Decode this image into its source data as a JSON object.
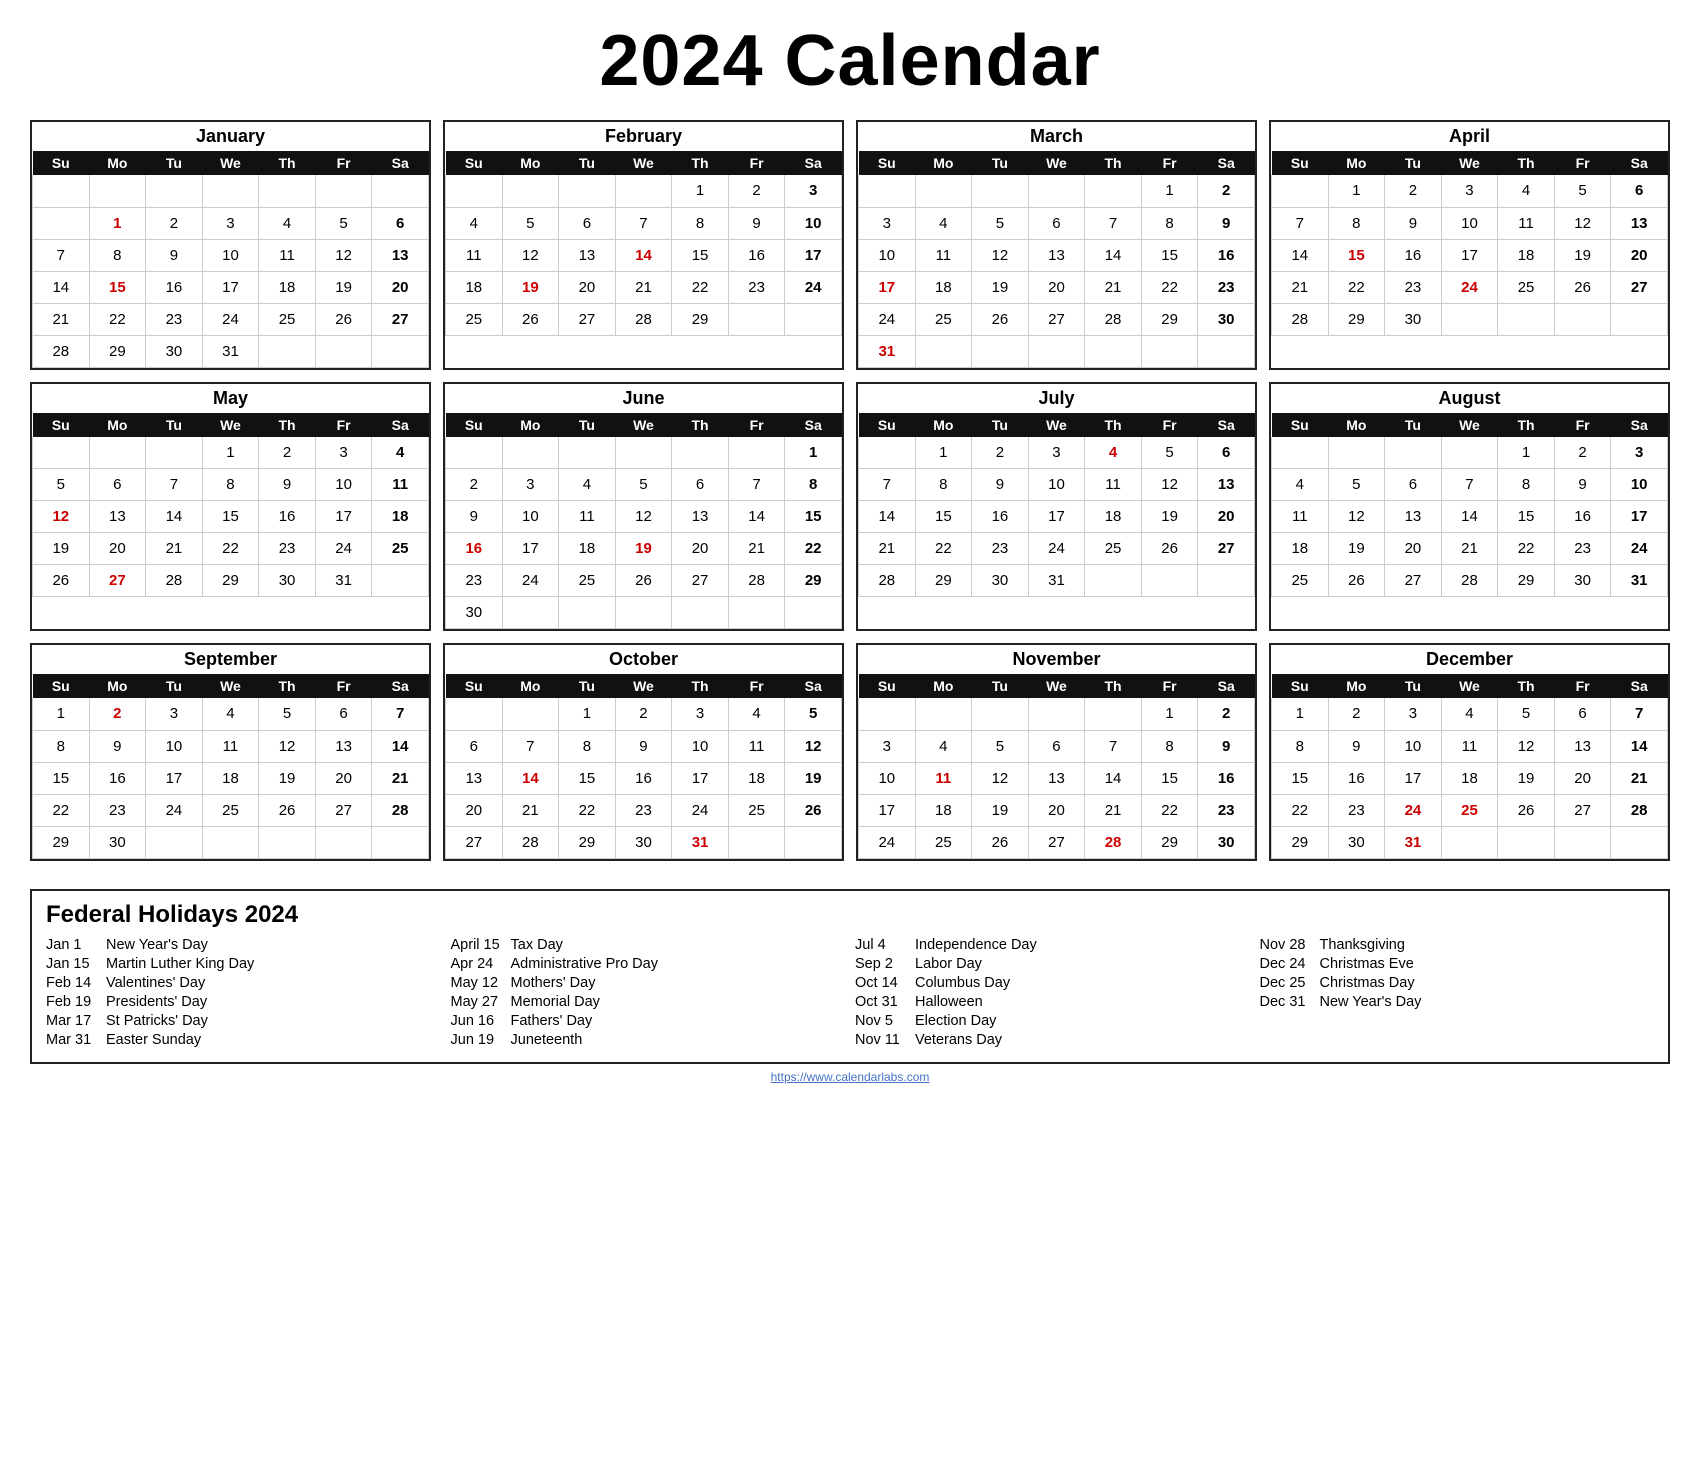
{
  "title": "2024 Calendar",
  "months": [
    {
      "name": "January",
      "days_header": [
        "Su",
        "Mo",
        "Tu",
        "We",
        "Th",
        "Fr",
        "Sa"
      ],
      "weeks": [
        [
          "",
          "",
          "",
          "",
          "",
          "",
          ""
        ],
        [
          "",
          "1",
          "2",
          "3",
          "4",
          "5",
          "6"
        ],
        [
          "7",
          "8",
          "9",
          "10",
          "11",
          "12",
          "13"
        ],
        [
          "14",
          "15",
          "16",
          "17",
          "18",
          "19",
          "20"
        ],
        [
          "21",
          "22",
          "23",
          "24",
          "25",
          "26",
          "27"
        ],
        [
          "28",
          "29",
          "30",
          "31",
          "",
          "",
          ""
        ]
      ],
      "red_dates": [
        "1",
        "15"
      ]
    },
    {
      "name": "February",
      "days_header": [
        "Su",
        "Mo",
        "Tu",
        "We",
        "Th",
        "Fr",
        "Sa"
      ],
      "weeks": [
        [
          "",
          "",
          "",
          "",
          "1",
          "2",
          "3"
        ],
        [
          "4",
          "5",
          "6",
          "7",
          "8",
          "9",
          "10"
        ],
        [
          "11",
          "12",
          "13",
          "14",
          "15",
          "16",
          "17"
        ],
        [
          "18",
          "19",
          "20",
          "21",
          "22",
          "23",
          "24"
        ],
        [
          "25",
          "26",
          "27",
          "28",
          "29",
          "",
          ""
        ]
      ],
      "red_dates": [
        "14",
        "19"
      ]
    },
    {
      "name": "March",
      "days_header": [
        "Su",
        "Mo",
        "Tu",
        "We",
        "Th",
        "Fr",
        "Sa"
      ],
      "weeks": [
        [
          "",
          "",
          "",
          "",
          "",
          "1",
          "2"
        ],
        [
          "3",
          "4",
          "5",
          "6",
          "7",
          "8",
          "9"
        ],
        [
          "10",
          "11",
          "12",
          "13",
          "14",
          "15",
          "16"
        ],
        [
          "17",
          "18",
          "19",
          "20",
          "21",
          "22",
          "23"
        ],
        [
          "24",
          "25",
          "26",
          "27",
          "28",
          "29",
          "30"
        ],
        [
          "31",
          "",
          "",
          "",
          "",
          "",
          ""
        ]
      ],
      "red_dates": [
        "17",
        "31"
      ]
    },
    {
      "name": "April",
      "days_header": [
        "Su",
        "Mo",
        "Tu",
        "We",
        "Th",
        "Fr",
        "Sa"
      ],
      "weeks": [
        [
          "",
          "1",
          "2",
          "3",
          "4",
          "5",
          "6"
        ],
        [
          "7",
          "8",
          "9",
          "10",
          "11",
          "12",
          "13"
        ],
        [
          "14",
          "15",
          "16",
          "17",
          "18",
          "19",
          "20"
        ],
        [
          "21",
          "22",
          "23",
          "24",
          "25",
          "26",
          "27"
        ],
        [
          "28",
          "29",
          "30",
          "",
          "",
          "",
          ""
        ]
      ],
      "red_dates": [
        "15",
        "24"
      ]
    },
    {
      "name": "May",
      "days_header": [
        "Su",
        "Mo",
        "Tu",
        "We",
        "Th",
        "Fr",
        "Sa"
      ],
      "weeks": [
        [
          "",
          "",
          "",
          "1",
          "2",
          "3",
          "4"
        ],
        [
          "5",
          "6",
          "7",
          "8",
          "9",
          "10",
          "11"
        ],
        [
          "12",
          "13",
          "14",
          "15",
          "16",
          "17",
          "18"
        ],
        [
          "19",
          "20",
          "21",
          "22",
          "23",
          "24",
          "25"
        ],
        [
          "26",
          "27",
          "28",
          "29",
          "30",
          "31",
          ""
        ]
      ],
      "red_dates": [
        "12",
        "27"
      ]
    },
    {
      "name": "June",
      "days_header": [
        "Su",
        "Mo",
        "Tu",
        "We",
        "Th",
        "Fr",
        "Sa"
      ],
      "weeks": [
        [
          "",
          "",
          "",
          "",
          "",
          "",
          "1"
        ],
        [
          "2",
          "3",
          "4",
          "5",
          "6",
          "7",
          "8"
        ],
        [
          "9",
          "10",
          "11",
          "12",
          "13",
          "14",
          "15"
        ],
        [
          "16",
          "17",
          "18",
          "19",
          "20",
          "21",
          "22"
        ],
        [
          "23",
          "24",
          "25",
          "26",
          "27",
          "28",
          "29"
        ],
        [
          "30",
          "",
          "",
          "",
          "",
          "",
          ""
        ]
      ],
      "red_dates": [
        "16",
        "19"
      ]
    },
    {
      "name": "July",
      "days_header": [
        "Su",
        "Mo",
        "Tu",
        "We",
        "Th",
        "Fr",
        "Sa"
      ],
      "weeks": [
        [
          "",
          "1",
          "2",
          "3",
          "4",
          "5",
          "6"
        ],
        [
          "7",
          "8",
          "9",
          "10",
          "11",
          "12",
          "13"
        ],
        [
          "14",
          "15",
          "16",
          "17",
          "18",
          "19",
          "20"
        ],
        [
          "21",
          "22",
          "23",
          "24",
          "25",
          "26",
          "27"
        ],
        [
          "28",
          "29",
          "30",
          "31",
          "",
          "",
          ""
        ]
      ],
      "red_dates": [
        "4"
      ]
    },
    {
      "name": "August",
      "days_header": [
        "Su",
        "Mo",
        "Tu",
        "We",
        "Th",
        "Fr",
        "Sa"
      ],
      "weeks": [
        [
          "",
          "",
          "",
          "",
          "1",
          "2",
          "3"
        ],
        [
          "4",
          "5",
          "6",
          "7",
          "8",
          "9",
          "10"
        ],
        [
          "11",
          "12",
          "13",
          "14",
          "15",
          "16",
          "17"
        ],
        [
          "18",
          "19",
          "20",
          "21",
          "22",
          "23",
          "24"
        ],
        [
          "25",
          "26",
          "27",
          "28",
          "29",
          "30",
          "31"
        ]
      ],
      "red_dates": []
    },
    {
      "name": "September",
      "days_header": [
        "Su",
        "Mo",
        "Tu",
        "We",
        "Th",
        "Fr",
        "Sa"
      ],
      "weeks": [
        [
          "1",
          "2",
          "3",
          "4",
          "5",
          "6",
          "7"
        ],
        [
          "8",
          "9",
          "10",
          "11",
          "12",
          "13",
          "14"
        ],
        [
          "15",
          "16",
          "17",
          "18",
          "19",
          "20",
          "21"
        ],
        [
          "22",
          "23",
          "24",
          "25",
          "26",
          "27",
          "28"
        ],
        [
          "29",
          "30",
          "",
          "",
          "",
          "",
          ""
        ]
      ],
      "red_dates": [
        "2"
      ]
    },
    {
      "name": "October",
      "days_header": [
        "Su",
        "Mo",
        "Tu",
        "We",
        "Th",
        "Fr",
        "Sa"
      ],
      "weeks": [
        [
          "",
          "",
          "1",
          "2",
          "3",
          "4",
          "5"
        ],
        [
          "6",
          "7",
          "8",
          "9",
          "10",
          "11",
          "12"
        ],
        [
          "13",
          "14",
          "15",
          "16",
          "17",
          "18",
          "19"
        ],
        [
          "20",
          "21",
          "22",
          "23",
          "24",
          "25",
          "26"
        ],
        [
          "27",
          "28",
          "29",
          "30",
          "31",
          "",
          ""
        ]
      ],
      "red_dates": [
        "14",
        "31"
      ]
    },
    {
      "name": "November",
      "days_header": [
        "Su",
        "Mo",
        "Tu",
        "We",
        "Th",
        "Fr",
        "Sa"
      ],
      "weeks": [
        [
          "",
          "",
          "",
          "",
          "",
          "1",
          "2"
        ],
        [
          "3",
          "4",
          "5",
          "6",
          "7",
          "8",
          "9"
        ],
        [
          "10",
          "11",
          "12",
          "13",
          "14",
          "15",
          "16"
        ],
        [
          "17",
          "18",
          "19",
          "20",
          "21",
          "22",
          "23"
        ],
        [
          "24",
          "25",
          "26",
          "27",
          "28",
          "29",
          "30"
        ]
      ],
      "red_dates": [
        "11",
        "28"
      ]
    },
    {
      "name": "December",
      "days_header": [
        "Su",
        "Mo",
        "Tu",
        "We",
        "Th",
        "Fr",
        "Sa"
      ],
      "weeks": [
        [
          "1",
          "2",
          "3",
          "4",
          "5",
          "6",
          "7"
        ],
        [
          "8",
          "9",
          "10",
          "11",
          "12",
          "13",
          "14"
        ],
        [
          "15",
          "16",
          "17",
          "18",
          "19",
          "20",
          "21"
        ],
        [
          "22",
          "23",
          "24",
          "25",
          "26",
          "27",
          "28"
        ],
        [
          "29",
          "30",
          "31",
          "",
          "",
          "",
          ""
        ]
      ],
      "red_dates": [
        "24",
        "25",
        "31"
      ]
    }
  ],
  "holidays_title": "Federal Holidays 2024",
  "holidays": [
    {
      "col": [
        {
          "date": "Jan 1",
          "name": "New Year's Day"
        },
        {
          "date": "Jan 15",
          "name": "Martin Luther King Day"
        },
        {
          "date": "Feb 14",
          "name": "Valentines' Day"
        },
        {
          "date": "Feb 19",
          "name": "Presidents' Day"
        },
        {
          "date": "Mar 17",
          "name": "St Patricks' Day"
        },
        {
          "date": "Mar 31",
          "name": "Easter Sunday"
        }
      ]
    },
    {
      "col": [
        {
          "date": "April 15",
          "name": "Tax Day"
        },
        {
          "date": "Apr 24",
          "name": "Administrative Pro Day"
        },
        {
          "date": "May 12",
          "name": "Mothers' Day"
        },
        {
          "date": "May 27",
          "name": "Memorial Day"
        },
        {
          "date": "Jun 16",
          "name": "Fathers' Day"
        },
        {
          "date": "Jun 19",
          "name": "Juneteenth"
        }
      ]
    },
    {
      "col": [
        {
          "date": "Jul 4",
          "name": "Independence Day"
        },
        {
          "date": "Sep 2",
          "name": "Labor Day"
        },
        {
          "date": "Oct 14",
          "name": "Columbus Day"
        },
        {
          "date": "Oct 31",
          "name": "Halloween"
        },
        {
          "date": "Nov 5",
          "name": "Election Day"
        },
        {
          "date": "Nov 11",
          "name": "Veterans Day"
        }
      ]
    },
    {
      "col": [
        {
          "date": "Nov 28",
          "name": "Thanksgiving"
        },
        {
          "date": "Dec 24",
          "name": "Christmas Eve"
        },
        {
          "date": "Dec 25",
          "name": "Christmas Day"
        },
        {
          "date": "Dec 31",
          "name": "New Year's Day"
        }
      ]
    }
  ],
  "footer_link": "https://www.calendarlabs.com"
}
